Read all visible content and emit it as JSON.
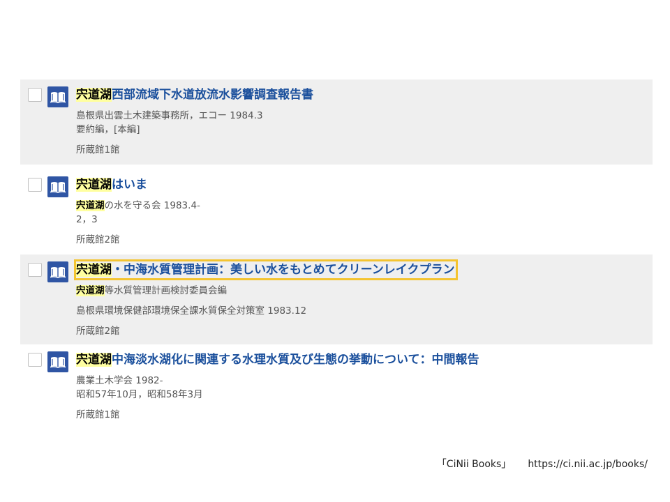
{
  "results": [
    {
      "title_highlight": "宍道湖",
      "title_rest": "西部流域下水道放流水影響調査報告書",
      "meta_line1_highlight": "",
      "meta_line1_rest": "島根県出雲土木建築事務所，エコー 1984.3",
      "meta_line2": "要約編，[本編]",
      "holding": "所蔵館1館"
    },
    {
      "title_highlight": "宍道湖",
      "title_rest": "はいま",
      "meta_line1_highlight": "宍道湖",
      "meta_line1_rest": "の水を守る会 1983.4-",
      "meta_line2": "2，3",
      "holding": "所蔵館2館"
    },
    {
      "title_highlight": "宍道湖",
      "title_rest": "・中海水質管理計画：美しい水をもとめてクリーンレイクプラン",
      "meta_line1_highlight": "宍道湖",
      "meta_line1_rest": "等水質管理計画検討委員会編",
      "meta_line2": "島根県環境保健部環境保全課水質保全対策室 1983.12",
      "holding": "所蔵館2館"
    },
    {
      "title_highlight": "宍道湖",
      "title_rest": "中海淡水湖化に関連する水理水質及び生態の挙動について：中間報告",
      "meta_line1_highlight": "",
      "meta_line1_rest": "農業土木学会 1982-",
      "meta_line2": "昭和57年10月，昭和58年3月",
      "holding": "所蔵館1館"
    }
  ],
  "footer": {
    "source": "「CiNii Books」",
    "url": "https://ci.nii.ac.jp/books/"
  },
  "colors": {
    "title": "#1a4f9c",
    "highlight": "#ffffa0",
    "selected_outline": "#f4c430",
    "row_shade": "#efefef",
    "book_icon": "#2f55a4"
  },
  "icons": {
    "book": "book-icon",
    "checkbox": "checkbox"
  }
}
